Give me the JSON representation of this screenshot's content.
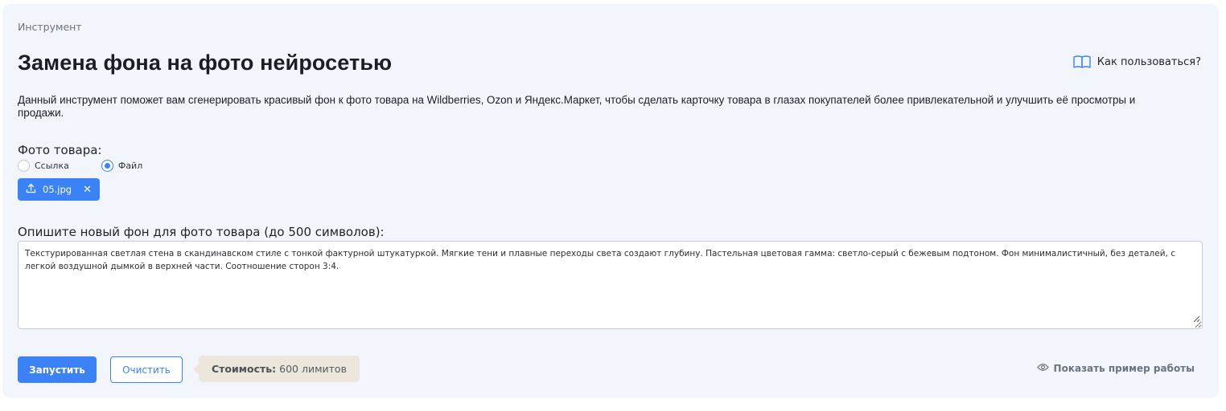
{
  "breadcrumb": "Инструмент",
  "title": "Замена фона на фото нейросетью",
  "help_link": {
    "label": "Как пользоваться?",
    "icon": "book-open-icon"
  },
  "description": "Данный инструмент поможет вам сгенерировать красивый фон к фото товара на Wildberries, Ozon и Яндекс.Маркет, чтобы сделать карточку товара в глазах покупателей более привлекательной и улучшить её просмотры и продажи.",
  "photo_section": {
    "label": "Фото товара:",
    "options": [
      {
        "label": "Ссылка",
        "selected": false
      },
      {
        "label": "Файл",
        "selected": true
      }
    ],
    "file": {
      "name": "05.jpg",
      "icon": "upload-icon"
    }
  },
  "background_section": {
    "label": "Опишите новый фон для фото товара (до 500 символов):",
    "value": "Текстурированная светлая стена в скандинавском стиле с тонкой фактурной штукатуркой. Мягкие тени и плавные переходы света создают глубину. Пастельная цветовая гамма: светло-серый с бежевым подтоном. Фон минималистичный, без деталей, с легкой воздушной дымкой в верхней части. Соотношение сторон 3:4."
  },
  "actions": {
    "run_label": "Запустить",
    "clear_label": "Очистить"
  },
  "cost": {
    "label": "Стоимость:",
    "value": "600 лимитов"
  },
  "example_link": {
    "label": "Показать пример работы",
    "icon": "eye-icon"
  },
  "colors": {
    "accent": "#3b82f6",
    "card_bg": "#f2f6fc",
    "cost_bg": "#ece6dc"
  }
}
